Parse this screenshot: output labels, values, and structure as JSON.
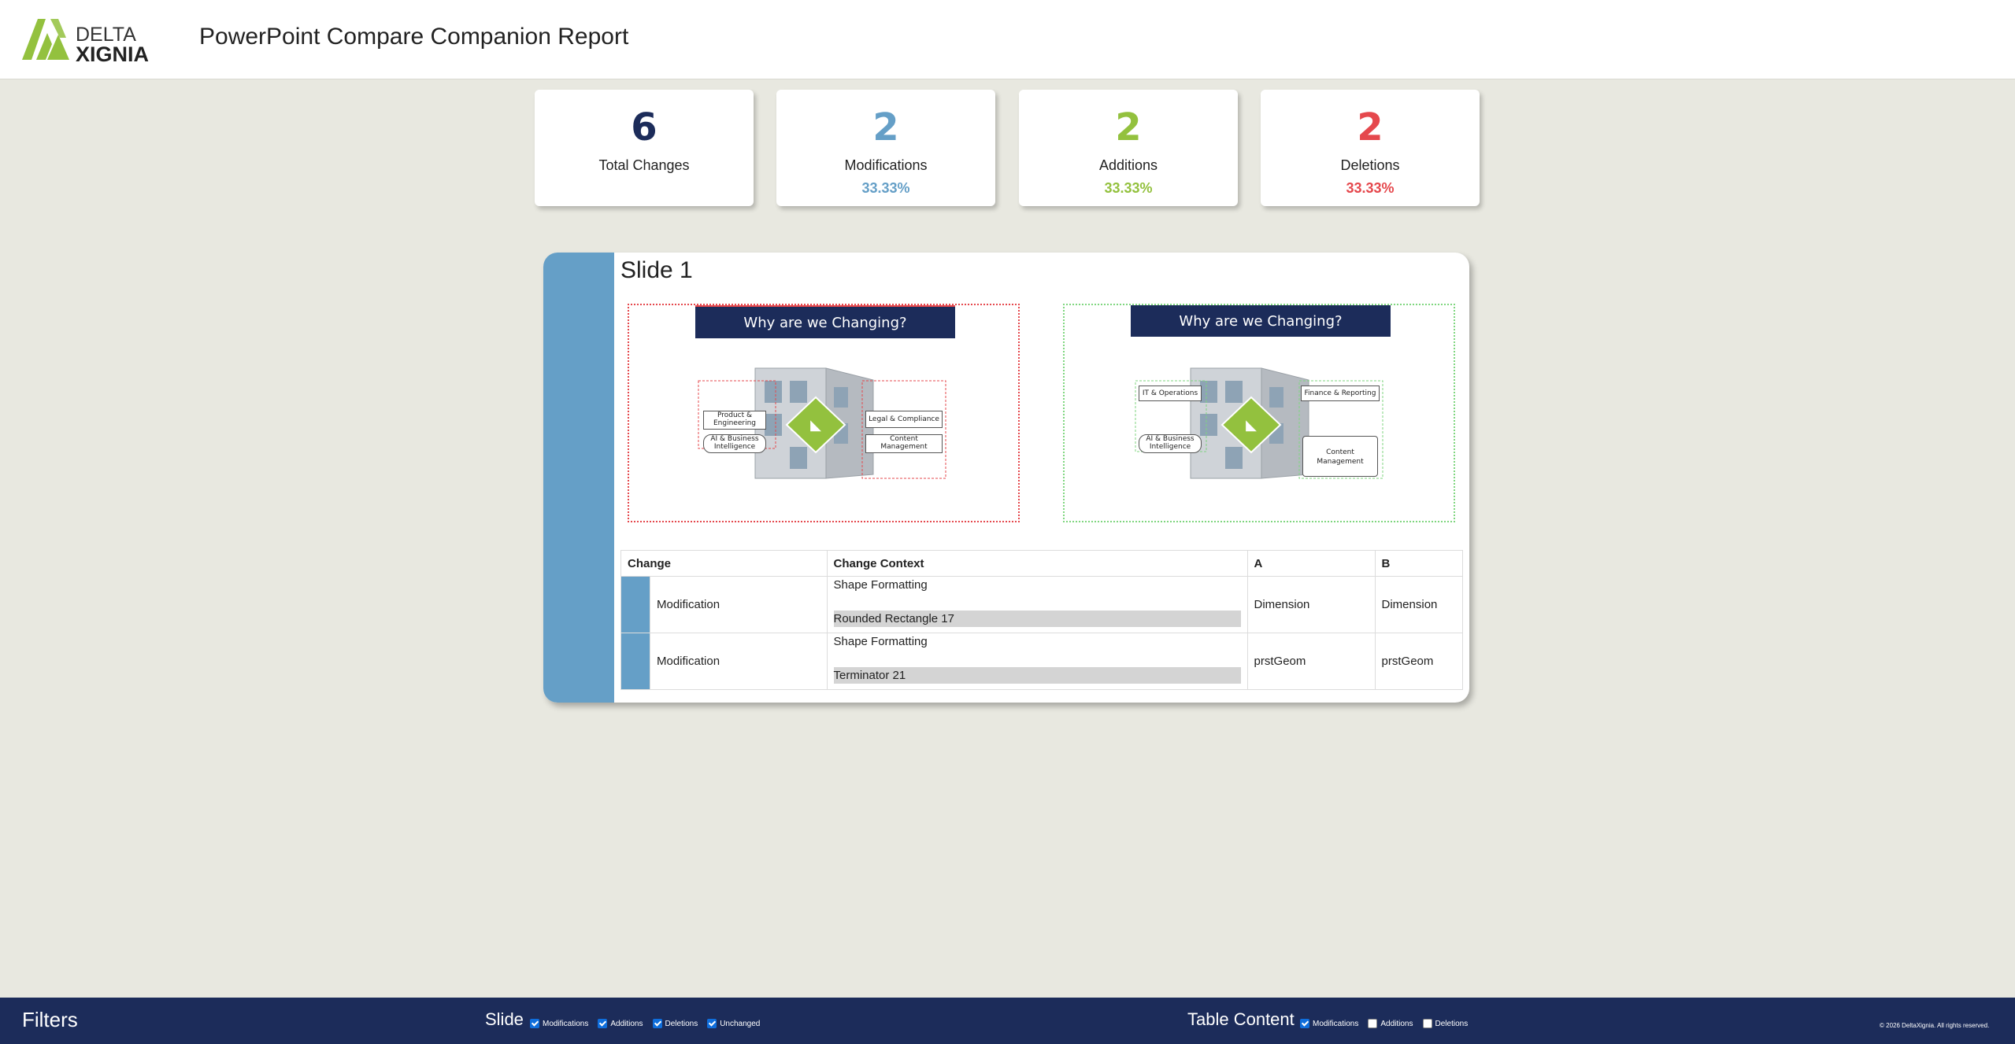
{
  "header": {
    "logo_text_1": "DELTA",
    "logo_text_2": "XIGNIA",
    "title": "PowerPoint Compare Companion Report"
  },
  "stats": [
    {
      "value": "6",
      "label": "Total Changes",
      "pct": "",
      "color": "#1c2c5a"
    },
    {
      "value": "2",
      "label": "Modifications",
      "pct": "33.33%",
      "color": "#659fc7"
    },
    {
      "value": "2",
      "label": "Additions",
      "pct": "33.33%",
      "color": "#93c13e"
    },
    {
      "value": "2",
      "label": "Deletions",
      "pct": "33.33%",
      "color": "#e5484d"
    }
  ],
  "slide": {
    "title": "Slide 1",
    "thumb_a": {
      "banner": "Why are we Changing?",
      "labels": [
        "Product  &",
        "Engineering",
        "AI & Business",
        "Intelligence",
        "Legal & Compliance",
        "Content",
        "Management"
      ]
    },
    "thumb_b": {
      "banner": "Why are we Changing?",
      "labels": [
        "IT & Operations",
        "Finance & Reporting",
        "AI & Business",
        "Intelligence",
        "Content",
        "Management"
      ]
    }
  },
  "table": {
    "headers": [
      "Change",
      "Change Context",
      "A",
      "B"
    ],
    "rows": [
      {
        "change": "Modification",
        "context": "Shape Formatting",
        "shape": "Rounded Rectangle 17",
        "a": "Dimension",
        "b": "Dimension"
      },
      {
        "change": "Modification",
        "context": "Shape Formatting",
        "shape": "Terminator 21",
        "a": "prstGeom",
        "b": "prstGeom"
      }
    ]
  },
  "footer": {
    "title": "Filters",
    "slide_group": {
      "label": "Slide",
      "options": [
        {
          "label": "Modifications",
          "checked": true
        },
        {
          "label": "Additions",
          "checked": true
        },
        {
          "label": "Deletions",
          "checked": true
        },
        {
          "label": "Unchanged",
          "checked": true
        }
      ]
    },
    "table_group": {
      "label": "Table Content",
      "options": [
        {
          "label": "Modifications",
          "checked": true
        },
        {
          "label": "Additions",
          "checked": false
        },
        {
          "label": "Deletions",
          "checked": false
        }
      ]
    },
    "copyright": "© 2026 DeltaXignia. All rights reserved."
  }
}
